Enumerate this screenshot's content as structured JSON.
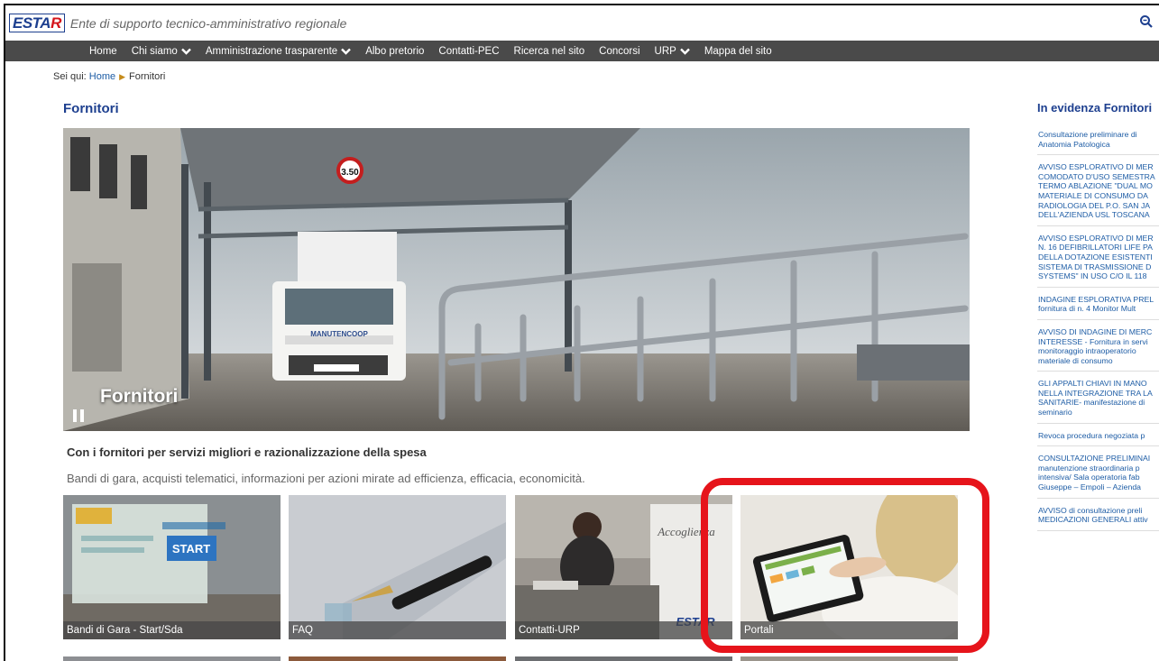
{
  "header": {
    "logo": {
      "main": "ESTA",
      "accent": "R"
    },
    "tagline": "Ente di supporto tecnico-amministrativo regionale"
  },
  "nav": [
    {
      "label": "Home",
      "dropdown": false
    },
    {
      "label": "Chi siamo",
      "dropdown": true
    },
    {
      "label": "Amministrazione trasparente",
      "dropdown": true
    },
    {
      "label": "Albo pretorio",
      "dropdown": false
    },
    {
      "label": "Contatti-PEC",
      "dropdown": false
    },
    {
      "label": "Ricerca nel sito",
      "dropdown": false
    },
    {
      "label": "Concorsi",
      "dropdown": false
    },
    {
      "label": "URP",
      "dropdown": true
    },
    {
      "label": "Mappa del sito",
      "dropdown": false
    }
  ],
  "breadcrumb": {
    "prefix": "Sei qui:",
    "home": "Home",
    "current": "Fornitori"
  },
  "page_title": "Fornitori",
  "hero": {
    "caption": "Fornitori",
    "truck_brand": "MANUTENCOOP",
    "sign": "3.50"
  },
  "subhead": "Con i fornitori per servizi migliori e razionalizzazione della spesa",
  "intro": "Bandi di gara, acquisti telematici, informazioni per azioni mirate ad efficienza, efficacia, economicità.",
  "tiles": [
    {
      "label": "Bandi di Gara - Start/Sda",
      "inner_text": "START"
    },
    {
      "label": "FAQ",
      "inner_text": ""
    },
    {
      "label": "Contatti-URP",
      "inner_text": "Accoglienza"
    },
    {
      "label": "Portali",
      "inner_text": ""
    }
  ],
  "sidebar": {
    "title": "In evidenza Fornitori",
    "items": [
      "Consultazione preliminare di\nAnatomia Patologica",
      "AVVISO ESPLORATIVO DI MER\nCOMODATO D'USO SEMESTRA\nTERMO ABLAZIONE \"DUAL MO\nMATERIALE DI CONSUMO DA\nRADIOLOGIA DEL P.O. SAN JA\nDELL'AZIENDA USL TOSCANA",
      "AVVISO ESPLORATIVO DI MER\nN. 16 DEFIBRILLATORI LIFE PA\nDELLA DOTAZIONE ESISTENTI\nSISTEMA DI TRASMISSIONE D\nSYSTEMS\" IN USO C/O IL 118",
      "INDAGINE ESPLORATIVA PREL\nfornitura di n. 4 Monitor Mult",
      "AVVISO DI INDAGINE DI MERC\nINTERESSE - Fornitura in servi\nmonitoraggio intraoperatorio\nmateriale di consumo",
      "GLI APPALTI CHIAVI IN MANO\nNELLA INTEGRAZIONE TRA LA\nSANITARIE- manifestazione di\nseminario",
      "Revoca procedura negoziata p",
      "CONSULTAZIONE PRELIMINAI\nmanutenzione straordinaria p\nintensiva/ Sala operatoria fab\nGiuseppe – Empoli – Azienda",
      "AVVISO di consultazione preli\nMEDICAZIONI GENERALI attiv"
    ]
  },
  "colors": {
    "brand_blue": "#1d3f8f",
    "link_blue": "#1d5ca5",
    "nav_bg": "#4a4a4a",
    "highlight": "#e6141b"
  }
}
